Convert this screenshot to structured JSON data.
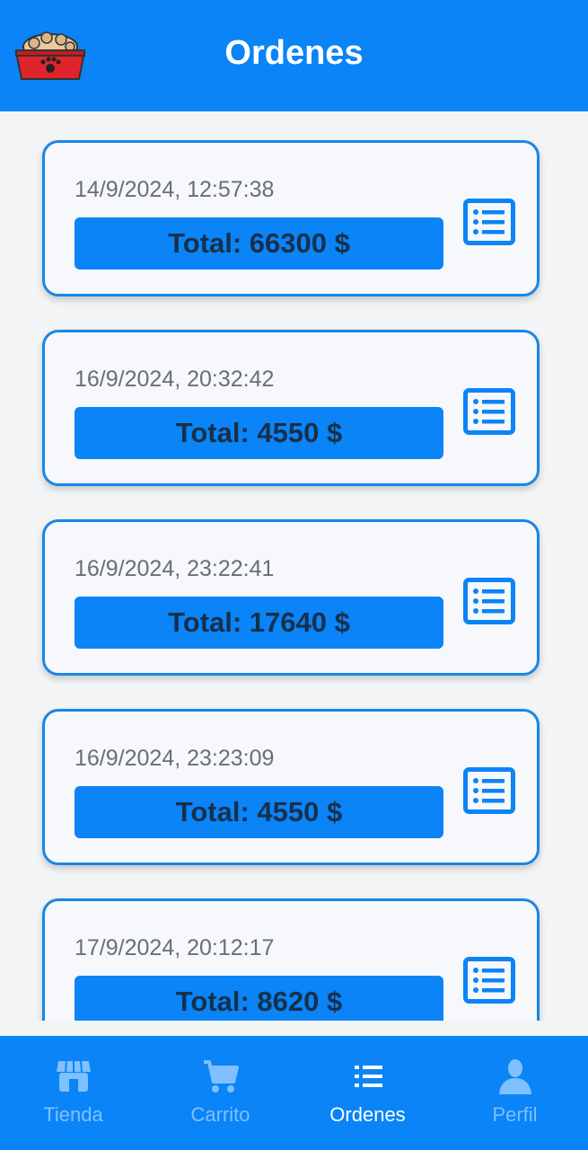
{
  "header": {
    "title": "Ordenes",
    "logo": "pet-food-bowl-icon"
  },
  "orders": [
    {
      "date": "14/9/2024, 12:57:38",
      "total": "Total: 66300 $"
    },
    {
      "date": "16/9/2024, 20:32:42",
      "total": "Total: 4550 $"
    },
    {
      "date": "16/9/2024, 23:22:41",
      "total": "Total: 17640 $"
    },
    {
      "date": "16/9/2024, 23:23:09",
      "total": "Total: 4550 $"
    },
    {
      "date": "17/9/2024, 20:12:17",
      "total": "Total: 8620 $"
    }
  ],
  "details_icon": "list-details-icon",
  "bottom_nav": {
    "active": "Ordenes",
    "tabs": [
      {
        "label": "Tienda",
        "icon": "store-icon"
      },
      {
        "label": "Carrito",
        "icon": "cart-icon"
      },
      {
        "label": "Ordenes",
        "icon": "list-icon"
      },
      {
        "label": "Perfil",
        "icon": "person-icon"
      }
    ]
  },
  "colors": {
    "primary": "#0a84f7",
    "card_border": "#1a86e6",
    "background": "#f2f4f6",
    "inactive_tab": "#7fc0ff"
  }
}
